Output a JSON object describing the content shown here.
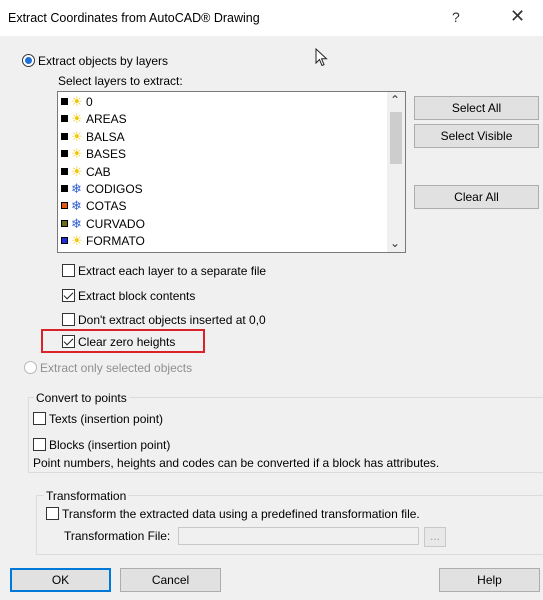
{
  "window": {
    "title": "Extract Coordinates from AutoCAD® Drawing",
    "help_glyph": "?",
    "close_glyph": "✕"
  },
  "mode": {
    "by_layers_label": "Extract objects by layers",
    "by_layers_selected": true,
    "selected_only_label": "Extract only selected objects",
    "selected_only_enabled": false
  },
  "layers": {
    "section_label": "Select layers to extract:",
    "items": [
      {
        "name": "0",
        "color": "#000000",
        "icon": "sun-icon"
      },
      {
        "name": "AREAS",
        "color": "#000000",
        "icon": "sun-icon"
      },
      {
        "name": "BALSA",
        "color": "#000000",
        "icon": "sun-icon"
      },
      {
        "name": "BASES",
        "color": "#000000",
        "icon": "sun-icon"
      },
      {
        "name": "CAB",
        "color": "#000000",
        "icon": "sun-icon"
      },
      {
        "name": "CODIGOS",
        "color": "#000000",
        "icon": "snowflake-icon"
      },
      {
        "name": "COTAS",
        "color": "#e05a1c",
        "icon": "snowflake-icon"
      },
      {
        "name": "CURVADO",
        "color": "#6b6b1a",
        "icon": "snowflake-icon"
      },
      {
        "name": "FORMATO",
        "color": "#1f2fd8",
        "icon": "sun-icon"
      }
    ],
    "buttons": {
      "select_all": "Select All",
      "select_visible": "Select Visible",
      "clear_all": "Clear All"
    }
  },
  "options": {
    "separate_file": {
      "label": "Extract each layer to a separate file",
      "checked": false
    },
    "block_contents": {
      "label": "Extract block contents",
      "checked": true
    },
    "dont_extract_origin": {
      "label": "Don't extract objects inserted at 0,0",
      "checked": false
    },
    "clear_zero_heights": {
      "label": "Clear zero heights",
      "checked": true
    }
  },
  "convert": {
    "group_label": "Convert to points",
    "texts": {
      "label": "Texts (insertion point)",
      "checked": false
    },
    "blocks": {
      "label": "Blocks (insertion point)",
      "checked": false
    },
    "note": "Point numbers, heights and codes can be converted if a block has attributes."
  },
  "transformation": {
    "group_label": "Transformation",
    "transform": {
      "label": "Transform the extracted data using a predefined transformation file.",
      "checked": false
    },
    "file_label": "Transformation File:",
    "file_value": "",
    "browse_label": "..."
  },
  "footer": {
    "ok": "OK",
    "cancel": "Cancel",
    "help": "Help"
  },
  "colors": {
    "accent": "#1e6fd9",
    "highlight": "#d9232a"
  }
}
